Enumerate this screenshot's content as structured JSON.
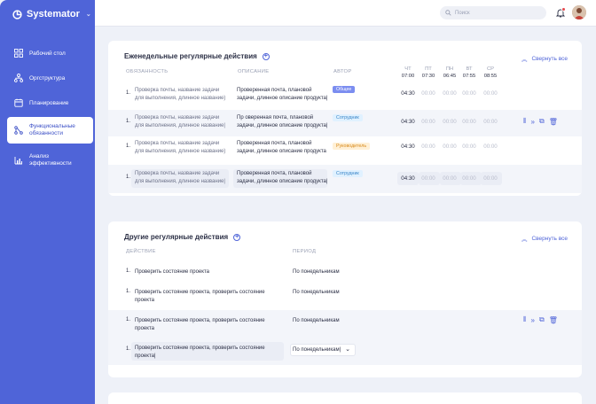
{
  "app": {
    "name": "Systemator"
  },
  "sidebar": {
    "items": [
      {
        "label": "Рабочий стол"
      },
      {
        "label": "Оргструктура"
      },
      {
        "label": "Планирование"
      },
      {
        "label_1": "Функциональные",
        "label_2": "обязанности"
      },
      {
        "label_1": "Анализ",
        "label_2": "эффективности"
      }
    ]
  },
  "topbar": {
    "search_placeholder": "Поиск"
  },
  "weekly": {
    "title": "Еженедельные регулярные действия",
    "collapse_label": "Свернуть все",
    "headers": {
      "duty": "ОБЯЗАННОСТЬ",
      "description": "ОПИСАНИЕ",
      "author": "АВТОР"
    },
    "days": [
      {
        "name": "ЧТ",
        "time": "07:00"
      },
      {
        "name": "ПТ",
        "time": "07:30"
      },
      {
        "name": "ПН",
        "time": "06:45"
      },
      {
        "name": "ВТ",
        "time": "07:55"
      },
      {
        "name": "СР",
        "time": "08:55"
      }
    ],
    "rows": [
      {
        "num": "1.",
        "duty_1": "Проверка почты, название задачи",
        "duty_2": "для выполнения, длинное название)",
        "desc_1": "Проверенная почта, плановой",
        "desc_2": "задачи, длинное описание продукта|",
        "author": "Общее",
        "times": [
          "04:30",
          "00:00",
          "00:00",
          "00:00",
          "00:00"
        ]
      },
      {
        "num": "1.",
        "duty_1": "Проверка почты, название задачи",
        "duty_2": "для выполнения, длинное название|",
        "desc_1": "Пр оверенная почта, плановой",
        "desc_2": "задачи, длинное описание продукта|",
        "author": "Сотрудник",
        "times": [
          "04:30",
          "00:00",
          "00:00",
          "00:00",
          "00:00"
        ]
      },
      {
        "num": "1.",
        "duty_1": "Проверка почты, название задачи",
        "duty_2": "для выполнения, длинное название)",
        "desc_1": "Проверенная почта, плановой",
        "desc_2": "задачи, длинное описание продукта",
        "author": "Руководитель",
        "times": [
          "04:30",
          "00:00",
          "00:00",
          "00:00",
          "00:00"
        ]
      },
      {
        "num": "1.",
        "duty_1": "Проверка почты, название задачи",
        "duty_2": "для выполнения, длинное название|",
        "desc_1": "Проверенная почта, плановой",
        "desc_2": "задачи, длинное описание продукта|",
        "author": "Сотрудник",
        "times": [
          "04:30",
          "00:00",
          "00:00",
          "00:00",
          "00:00"
        ]
      }
    ]
  },
  "other": {
    "title": "Другие регулярные действия",
    "collapse_label": "Свернуть все",
    "headers": {
      "action": "ДЕЙСТВИЕ",
      "period": "ПЕРИОД"
    },
    "rows": [
      {
        "num": "1.",
        "action_1": "Проверить состояние проекта",
        "action_2": "",
        "period": "По понедельникам"
      },
      {
        "num": "1.",
        "action_1": "Проверить состояние проекта, проверить состояние",
        "action_2": "проекта",
        "period": "По понедельникам"
      },
      {
        "num": "1.",
        "action_1": "Проверить состояние проекта, проверить состояние",
        "action_2": "проекта",
        "period": "По понедельникам"
      },
      {
        "num": "1.",
        "action_1": "Проверить состояние проекта, проверить состояние",
        "action_2": "проекта|",
        "period": "По понедельникам|"
      }
    ]
  },
  "colors": {
    "accent": "#4f64d8",
    "sidebar": "#4f64d8"
  }
}
